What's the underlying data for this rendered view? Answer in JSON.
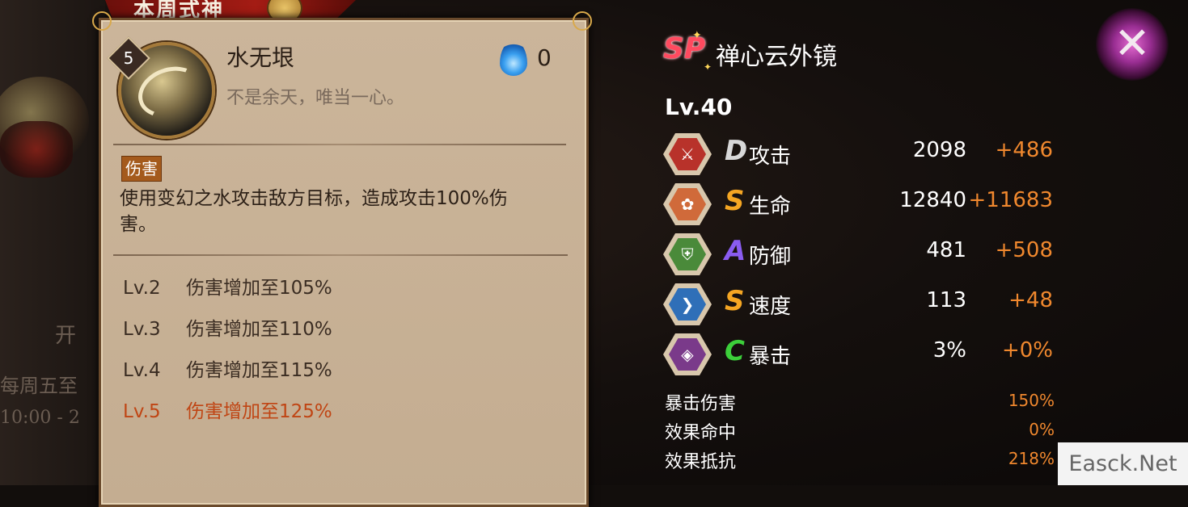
{
  "background": {
    "side_texts": [
      "开",
      "每周五至",
      "10:00 - 2"
    ]
  },
  "banner": {
    "title": "本周式神",
    "badge_icon": "crown-icon"
  },
  "skill": {
    "level": "5",
    "name": "水无垠",
    "quote": "不是余天，唯当一心。",
    "icon": "water-swirl-skill-icon",
    "fire_cost_icon": "blue-ghost-fire-icon",
    "fire_cost": "0",
    "tag": "伤害",
    "description": "使用变幻之水攻击敌方目标，造成攻击100%伤害。",
    "upgrades": [
      {
        "lv": "Lv.2",
        "text": "伤害增加至105%"
      },
      {
        "lv": "Lv.3",
        "text": "伤害增加至110%"
      },
      {
        "lv": "Lv.4",
        "text": "伤害增加至115%"
      },
      {
        "lv": "Lv.5",
        "text": "伤害增加至125%"
      }
    ]
  },
  "shikigami": {
    "rarity": "SP",
    "name": "禅心云外镜",
    "level": "Lv.40"
  },
  "stats": [
    {
      "grade": "D",
      "grade_color": "#d8d8d8",
      "name": "攻击",
      "base": "2098",
      "bonus": "+486",
      "icon": "attack-icon",
      "icon_color": "#b8322a"
    },
    {
      "grade": "S",
      "grade_color": "#f5a623",
      "name": "生命",
      "base": "12840",
      "bonus": "+11683",
      "icon": "health-icon",
      "icon_color": "#d06a3a"
    },
    {
      "grade": "A",
      "grade_color": "#8a5cf0",
      "name": "防御",
      "base": "481",
      "bonus": "+508",
      "icon": "defense-icon",
      "icon_color": "#4a8a3a"
    },
    {
      "grade": "S",
      "grade_color": "#f5a623",
      "name": "速度",
      "base": "113",
      "bonus": "+48",
      "icon": "speed-icon",
      "icon_color": "#2f6fb8"
    },
    {
      "grade": "C",
      "grade_color": "#3ccf3a",
      "name": "暴击",
      "base": "3%",
      "bonus": "+0%",
      "icon": "crit-icon",
      "icon_color": "#7a3a8a"
    }
  ],
  "secondary_stats": [
    {
      "name": "暴击伤害",
      "value": "150%"
    },
    {
      "name": "效果命中",
      "value": "0%"
    },
    {
      "name": "效果抵抗",
      "value": "218%"
    }
  ],
  "close_icon": "close-icon",
  "watermark": "Easck.Net"
}
